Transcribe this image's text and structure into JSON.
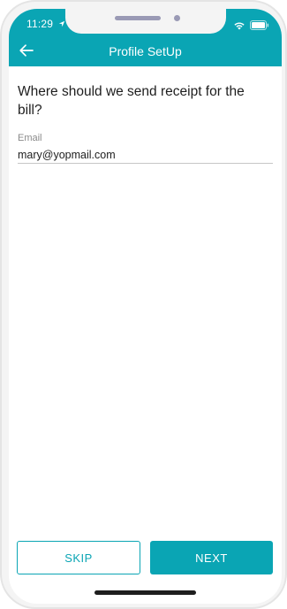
{
  "status_bar": {
    "time": "11:29"
  },
  "header": {
    "title": "Profile SetUp"
  },
  "form": {
    "question": "Where should we send receipt for the bill?",
    "email_label": "Email",
    "email_value": "mary@yopmail.com"
  },
  "actions": {
    "skip_label": "SKIP",
    "next_label": "NEXT"
  },
  "colors": {
    "accent": "#0aa5b4"
  },
  "icons": {
    "back": "arrow-left-icon",
    "location": "location-arrow-icon",
    "wifi": "wifi-icon",
    "battery": "battery-icon"
  }
}
